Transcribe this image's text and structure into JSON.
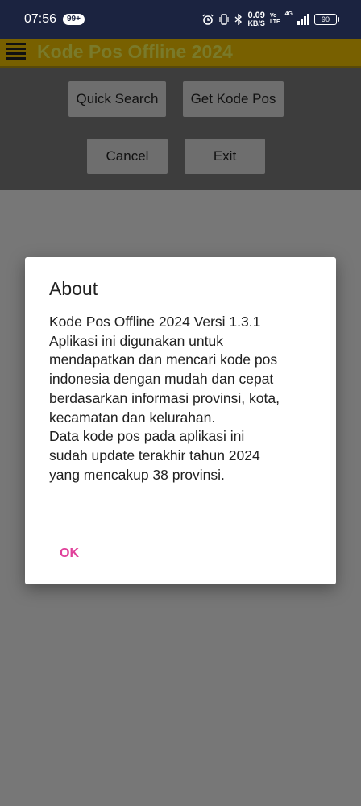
{
  "status_bar": {
    "time": "07:56",
    "notification_badge": "99+",
    "icons": [
      "alarm-icon",
      "vibrate-icon",
      "bluetooth-icon",
      "signal-icon"
    ],
    "net_speed_value": "0.09",
    "net_speed_unit": "KB/S",
    "volte_top": "Vo",
    "volte_bottom": "LTE",
    "network_type": "4G",
    "battery": "90"
  },
  "toolbar": {
    "title": "Kode Pos Offline 2024",
    "menu_icon": "hamburger-menu-icon"
  },
  "main": {
    "buttons": {
      "quick_search": "Quick Search",
      "get_kode_pos": "Get Kode Pos",
      "cancel": "Cancel",
      "exit": "Exit"
    }
  },
  "dialog": {
    "title": "About",
    "lines": [
      "Kode Pos Offline 2024 Versi 1.3.1",
      "Aplikasi ini digunakan untuk",
      "mendapatkan dan mencari kode pos",
      "indonesia dengan mudah dan cepat",
      "berdasarkan informasi provinsi, kota,",
      "kecamatan dan kelurahan.",
      "Data kode pos pada aplikasi ini",
      "sudah update terakhir tahun 2024",
      "yang mencakup 38 provinsi."
    ],
    "ok_label": "OK"
  },
  "colors": {
    "accent": "#e0409a",
    "toolbar_dimmed": "#786000",
    "status_bar": "#1b2340",
    "scrim": "#777777"
  }
}
